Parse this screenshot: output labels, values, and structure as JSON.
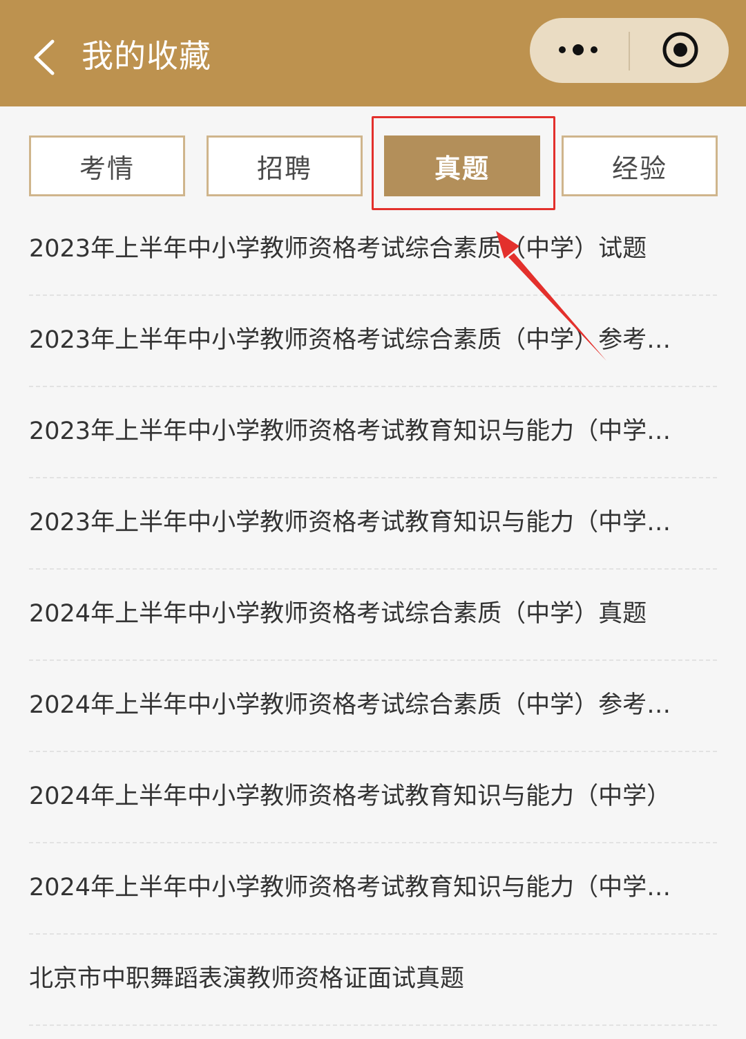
{
  "header": {
    "title": "我的收藏",
    "back_icon": "chevron-left-icon",
    "more_icon": "more-dots-icon",
    "close_icon": "target-circle-icon",
    "background_color": "#bd924f"
  },
  "tabs": [
    {
      "label": "考情",
      "active": false
    },
    {
      "label": "招聘",
      "active": false
    },
    {
      "label": "真题",
      "active": true
    },
    {
      "label": "经验",
      "active": false
    }
  ],
  "annotation": {
    "highlight_color": "#e3302c"
  },
  "list": [
    {
      "title": "2023年上半年中小学教师资格考试综合素质（中学）试题"
    },
    {
      "title": "2023年上半年中小学教师资格考试综合素质（中学）参考…"
    },
    {
      "title": "2023年上半年中小学教师资格考试教育知识与能力（中学…"
    },
    {
      "title": "2023年上半年中小学教师资格考试教育知识与能力（中学…"
    },
    {
      "title": "2024年上半年中小学教师资格考试综合素质（中学）真题"
    },
    {
      "title": "2024年上半年中小学教师资格考试综合素质（中学）参考…"
    },
    {
      "title": "2024年上半年中小学教师资格考试教育知识与能力（中学）"
    },
    {
      "title": "2024年上半年中小学教师资格考试教育知识与能力（中学…"
    },
    {
      "title": "北京市中职舞蹈表演教师资格证面试真题"
    }
  ]
}
